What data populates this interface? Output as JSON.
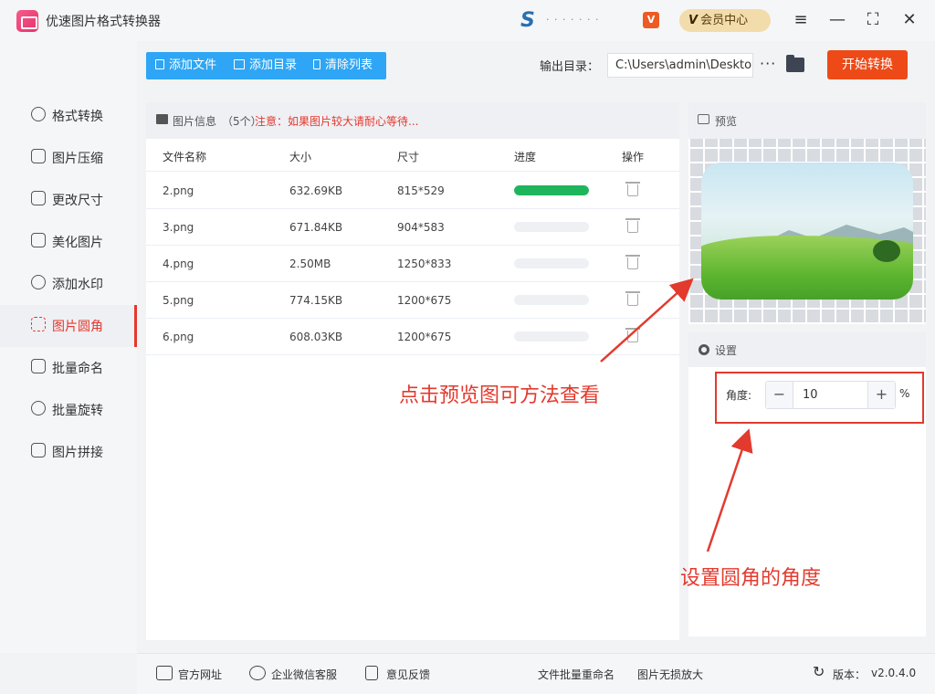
{
  "window": {
    "title": "优速图片格式转换器",
    "brand_name": "· · · · · · ·",
    "member_center": "会员中心",
    "vip_mark": "V",
    "brand_badge": "V"
  },
  "sidebar": {
    "items": [
      {
        "label": "格式转换",
        "icon": "format-convert-icon"
      },
      {
        "label": "图片压缩",
        "icon": "compress-icon"
      },
      {
        "label": "更改尺寸",
        "icon": "resize-icon"
      },
      {
        "label": "美化图片",
        "icon": "beautify-icon"
      },
      {
        "label": "添加水印",
        "icon": "watermark-icon"
      },
      {
        "label": "图片圆角",
        "icon": "round-corner-icon",
        "active": true
      },
      {
        "label": "批量命名",
        "icon": "rename-icon"
      },
      {
        "label": "批量旋转",
        "icon": "rotate-icon"
      },
      {
        "label": "图片拼接",
        "icon": "stitch-icon"
      }
    ]
  },
  "toolbar": {
    "add_file": "添加文件",
    "add_folder": "添加目录",
    "clear_list": "清除列表",
    "output_label": "输出目录：",
    "output_path": "C:\\Users\\admin\\Deskto",
    "more": "···",
    "start": "开始转换"
  },
  "file_panel": {
    "title": "图片信息",
    "count": "（5个）",
    "note": "注意：如果图片较大请耐心等待...",
    "columns": [
      "文件名称",
      "大小",
      "尺寸",
      "进度",
      "操作"
    ],
    "rows": [
      {
        "name": "2.png",
        "size": "632.69KB",
        "dims": "815*529",
        "progress": 1.0
      },
      {
        "name": "3.png",
        "size": "671.84KB",
        "dims": "904*583",
        "progress": 0
      },
      {
        "name": "4.png",
        "size": "2.50MB",
        "dims": "1250*833",
        "progress": 0
      },
      {
        "name": "5.png",
        "size": "774.15KB",
        "dims": "1200*675",
        "progress": 0
      },
      {
        "name": "6.png",
        "size": "608.03KB",
        "dims": "1200*675",
        "progress": 0
      }
    ]
  },
  "preview": {
    "title": "预览"
  },
  "settings": {
    "title": "设置",
    "angle_label": "角度:",
    "angle_value": "10",
    "minus": "−",
    "plus": "+",
    "unit": "%"
  },
  "annotations": {
    "preview_hint": "点击预览图可方法查看",
    "angle_hint": "设置圆角的角度"
  },
  "footer": {
    "website": "官方网址",
    "wechat": "企业微信客服",
    "feedback": "意见反馈",
    "batch_rename": "文件批量重命名",
    "lossless_zoom": "图片无损放大",
    "version_label": "版本：",
    "version": "v2.0.4.0"
  },
  "colors": {
    "accent_blue": "#2ea6f5",
    "start_orange": "#ee4a17",
    "active_red": "#e7372c",
    "progress_green": "#1fb55c",
    "annotation_red": "#e33a2e"
  }
}
